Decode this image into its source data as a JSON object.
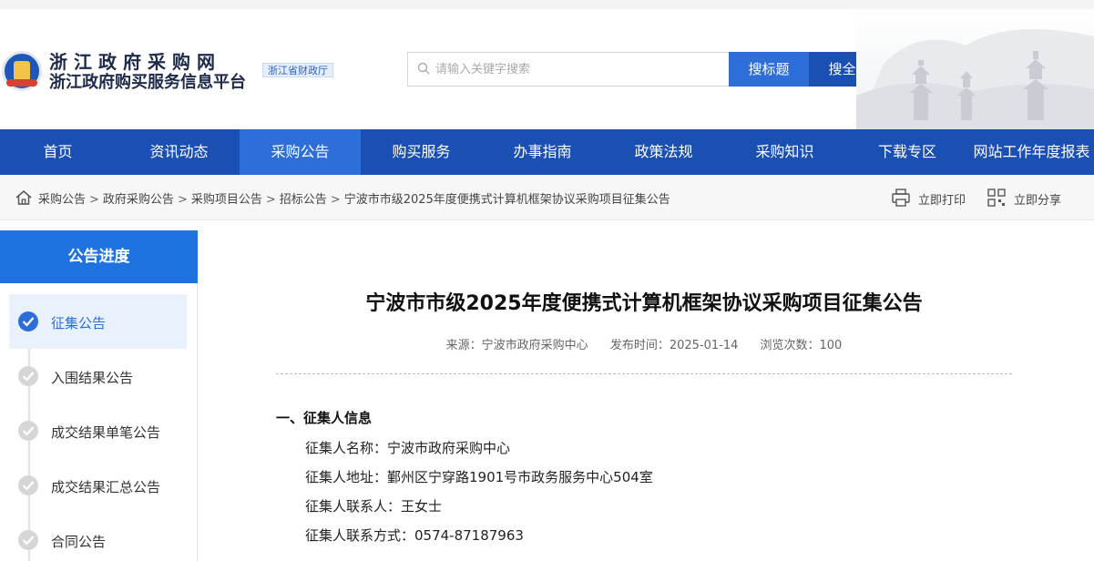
{
  "header": {
    "title_line1": "浙江政府采购网",
    "title_line2": "浙江政府购买服务信息平台",
    "dept_badge": "浙江省财政厅",
    "search": {
      "placeholder": "请输入关键字搜索",
      "btn_title": "搜标题",
      "btn_full": "搜全文"
    }
  },
  "nav": {
    "items": [
      "首页",
      "资讯动态",
      "采购公告",
      "购买服务",
      "办事指南",
      "政策法规",
      "采购知识",
      "下载专区",
      "网站工作年度报表"
    ],
    "active_index": 2
  },
  "breadcrumb": {
    "items": [
      "采购公告",
      "政府采购公告",
      "采购项目公告",
      "招标公告",
      "宁波市市级2025年度便携式计算机框架协议采购项目征集公告"
    ],
    "separator": ">"
  },
  "tools": {
    "print": "立即打印",
    "share": "立即分享"
  },
  "sidebar": {
    "heading": "公告进度",
    "steps": [
      "征集公告",
      "入围结果公告",
      "成交结果单笔公告",
      "成交结果汇总公告",
      "合同公告"
    ],
    "active_index": 0
  },
  "article": {
    "title": "宁波市市级2025年度便携式计算机框架协议采购项目征集公告",
    "source": "来源：宁波市政府采购中心",
    "publish_time": "发布时间：2025-01-14",
    "views": "浏览次数：100",
    "section1_heading": "一、征集人信息",
    "fields": [
      "征集人名称：宁波市政府采购中心",
      "征集人地址：鄞州区宁穿路1901号市政务服务中心504室",
      "征集人联系人：王女士",
      "征集人联系方式：0574-87187963"
    ]
  },
  "colors": {
    "nav_bg": "#1a4fb4",
    "nav_active": "#2d6ed9",
    "sidebar_head": "#1f73e0"
  }
}
